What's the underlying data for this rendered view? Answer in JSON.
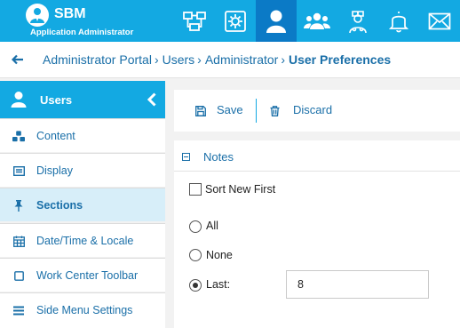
{
  "app": {
    "brand": "SBM",
    "role": "Application Administrator",
    "colors": {
      "accent": "#13a9e2",
      "active_nav": "#0b7ac6",
      "link": "#1a6fa8",
      "sidebar_active": "#d7eef9"
    }
  },
  "topnav": {
    "icons": [
      "workflow-icon",
      "settings-icon",
      "user-icon",
      "groups-icon",
      "doctor-icon",
      "bell-icon",
      "mail-icon"
    ],
    "active": "user-icon"
  },
  "breadcrumb": {
    "items": [
      "Administrator Portal",
      "Users",
      "Administrator"
    ],
    "separator": "›",
    "current": "User Preferences"
  },
  "sidebar": {
    "header": "Users",
    "items": [
      {
        "label": "Content",
        "icon": "cubes-icon"
      },
      {
        "label": "Display",
        "icon": "list-icon"
      },
      {
        "label": "Sections",
        "icon": "pin-icon",
        "active": true
      },
      {
        "label": "Date/Time & Locale",
        "icon": "calendar-icon"
      },
      {
        "label": "Work Center Toolbar",
        "icon": "square-icon"
      },
      {
        "label": "Side Menu Settings",
        "icon": "menu-icon"
      }
    ]
  },
  "toolbar": {
    "save_label": "Save",
    "discard_label": "Discard"
  },
  "notes": {
    "title": "Notes",
    "sort_new_first_label": "Sort New First",
    "sort_new_first_checked": false,
    "options": [
      {
        "label": "All",
        "checked": false
      },
      {
        "label": "None",
        "checked": false
      },
      {
        "label": "Last:",
        "checked": true
      }
    ],
    "last_count": "8"
  }
}
